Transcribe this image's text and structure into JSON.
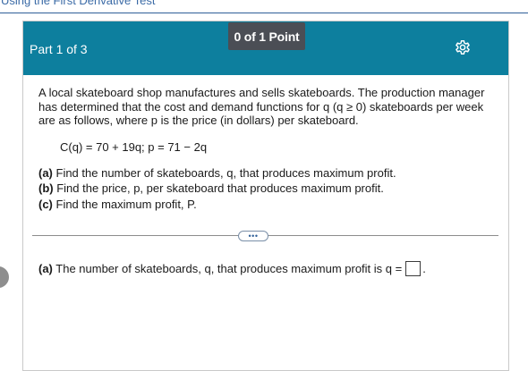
{
  "page": {
    "title": "Using the First Derivative Test"
  },
  "header": {
    "part": "Part 1 of 3",
    "points": "0 of 1 Point",
    "settings_icon": "gear-icon",
    "color": "#0d7f9e"
  },
  "question": {
    "intro": "A local skateboard shop manufactures and sells skateboards. The production manager has determined that the cost and demand functions for q (q ≥ 0) skateboards per week are as follows, where p is the price (in dollars) per skateboard.",
    "equation": "C(q) = 70 + 19q;  p = 71 − 2q",
    "tasks": [
      {
        "label": "(a)",
        "text": " Find the number of skateboards, q, that produces maximum profit."
      },
      {
        "label": "(b)",
        "text": " Find the price, p, per skateboard that produces maximum profit."
      },
      {
        "label": "(c)",
        "text": " Find the maximum profit, P."
      }
    ]
  },
  "expand_button": {
    "label": "•••",
    "icon": "more-icon"
  },
  "answer": {
    "label": "(a)",
    "text": " The number of skateboards, q, that produces maximum profit is q =",
    "value": "",
    "suffix": "."
  }
}
